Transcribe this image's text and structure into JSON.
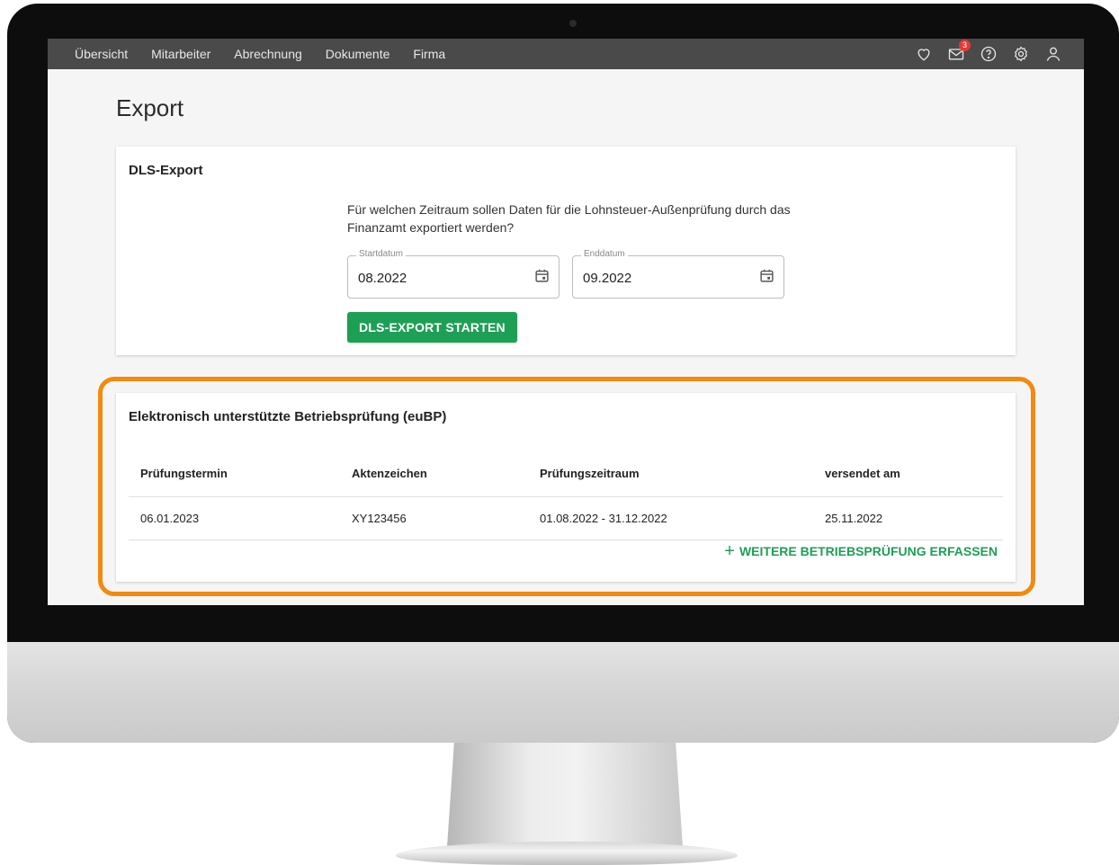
{
  "nav": {
    "items": [
      "Übersicht",
      "Mitarbeiter",
      "Abrechnung",
      "Dokumente",
      "Firma"
    ],
    "icons": [
      "heart-icon",
      "mail-icon",
      "help-icon",
      "gear-icon",
      "user-icon"
    ],
    "mail_badge": "3"
  },
  "page": {
    "title": "Export"
  },
  "dls": {
    "title": "DLS-Export",
    "question": "Für welchen Zeitraum sollen Daten für die Lohnsteuer-Außenprüfung durch das Finanzamt exportiert werden?",
    "start_label": "Startdatum",
    "start_value": "08.2022",
    "end_label": "Enddatum",
    "end_value": "09.2022",
    "button": "DLS-EXPORT STARTEN"
  },
  "eubp": {
    "title": "Elektronisch unterstützte Betriebsprüfung (euBP)",
    "columns": [
      "Prüfungstermin",
      "Aktenzeichen",
      "Prüfungszeitraum",
      "versendet am"
    ],
    "rows": [
      [
        "06.01.2023",
        "XY123456",
        "01.08.2022 - 31.12.2022",
        "25.11.2022"
      ]
    ],
    "add_link": "WEITERE BETRIEBSPRÜFUNG ERFASSEN"
  },
  "colors": {
    "accent_green": "#1e9f56",
    "highlight_orange": "#f28a0f",
    "nav_bg": "#4a4a4a",
    "badge_red": "#e53935"
  }
}
